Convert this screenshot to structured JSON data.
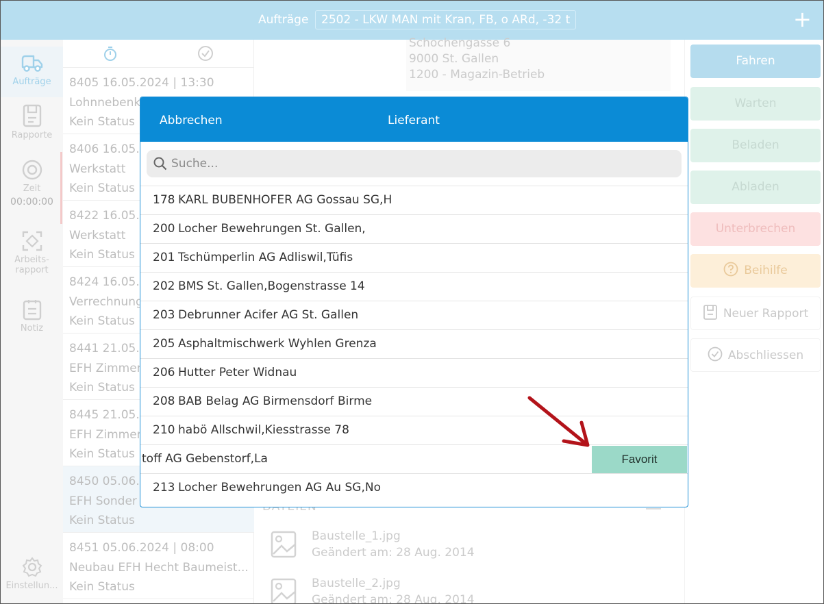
{
  "header": {
    "title": "Aufträge",
    "order_label": "2502 - LKW MAN mit Kran, FB, o ARd, -32 t",
    "plus": "+"
  },
  "sidebar": {
    "items": [
      {
        "label": "Aufträge",
        "icon": "truck-icon"
      },
      {
        "label": "Rapporte",
        "icon": "document-icon"
      },
      {
        "label": "Zeit",
        "icon": "record-icon",
        "value": "00:00:00"
      },
      {
        "label": "Arbeits-\nrapport",
        "label_line1": "Arbeits-",
        "label_line2": "rapport",
        "icon": "scan-icon"
      },
      {
        "label": "Notiz",
        "icon": "clipboard-icon"
      },
      {
        "label": "Einstellun...",
        "icon": "settings-icon"
      }
    ]
  },
  "order_list": {
    "tabs": [
      "stopwatch-icon",
      "check-circle-icon"
    ],
    "orders": [
      {
        "line1": "8405  16.05.2024 | 13:30",
        "line2": "Lohnnebenk",
        "line3": "Kein Status"
      },
      {
        "line1": "8406  16.05.",
        "line2": "Werkstatt",
        "line3": "Kein Status"
      },
      {
        "line1": "8422  16.05.",
        "line2": "Werkstatt",
        "line3": "Kein Status"
      },
      {
        "line1": "8424  16.05.",
        "line2": "Verrechnung",
        "line3": "Kein Status"
      },
      {
        "line1": "8441  21.05.",
        "line2": "EFH Zimmer",
        "line3": "Kein Status"
      },
      {
        "line1": "8445  21.05.",
        "line2": "EFH Zimmer",
        "line3": "Kein Status"
      },
      {
        "line1": "8450  05.06.",
        "line2": "EFH Sonder",
        "line3": "Kein Status"
      },
      {
        "line1": "8451  05.06.2024 | 08:00",
        "line2": "Neubau EFH Hecht Baumeist...",
        "line3": "Kein Status"
      }
    ]
  },
  "detail": {
    "address": [
      "Schochengasse 6",
      "9000 St. Gallen",
      "1200 - Magazin-Betrieb"
    ],
    "files_title": "DATEIEN",
    "files": [
      {
        "name": "Baustelle_1.jpg",
        "date": "Geändert am: 28 Aug. 2014"
      },
      {
        "name": "Baustelle_2.jpg",
        "date": "Geändert am: 28 Aug. 2014"
      }
    ]
  },
  "actions": {
    "drive": "Fahren",
    "wait": "Warten",
    "load": "Beladen",
    "unload": "Abladen",
    "interrupt": "Unterbrechen",
    "help": "Beihilfe",
    "new_report": "Neuer Rapport",
    "finish": "Abschliessen",
    "colors": {
      "drive": "#b5dcee",
      "green": "#dff2ea",
      "red": "#fde1e1",
      "orange": "#fdefd9"
    }
  },
  "modal": {
    "cancel": "Abbrechen",
    "title": "Lieferant",
    "search_placeholder": "Suche...",
    "rows": [
      {
        "num": "178",
        "name": "KARL BUBENHOFER AG Gossau SG,H"
      },
      {
        "num": "200",
        "name": "Locher Bewehrungen St. Gallen,"
      },
      {
        "num": "201",
        "name": "Tschümperlin AG Adliswil,Tüfis"
      },
      {
        "num": "202",
        "name": "BMS St. Gallen,Bogenstrasse 14"
      },
      {
        "num": "203",
        "name": "Debrunner Acifer AG St. Gallen"
      },
      {
        "num": "205",
        "name": "Asphaltmischwerk Wyhlen Grenza"
      },
      {
        "num": "206",
        "name": "Hutter Peter Widnau"
      },
      {
        "num": "208",
        "name": "BAB Belag AG Birmensdorf Birme"
      },
      {
        "num": "210",
        "name": "habö Allschwil,Kiesstrasse 78"
      }
    ],
    "swiped_row": {
      "text": "toff AG Gebenstorf,La",
      "action": "Favorit"
    },
    "last_row": {
      "num": "213",
      "name": "Locher Bewehrungen AG Au SG,No"
    },
    "accent": "#0b8bd6",
    "favorite_color": "#9bd9c8",
    "arrow_color": "#b3131a"
  }
}
